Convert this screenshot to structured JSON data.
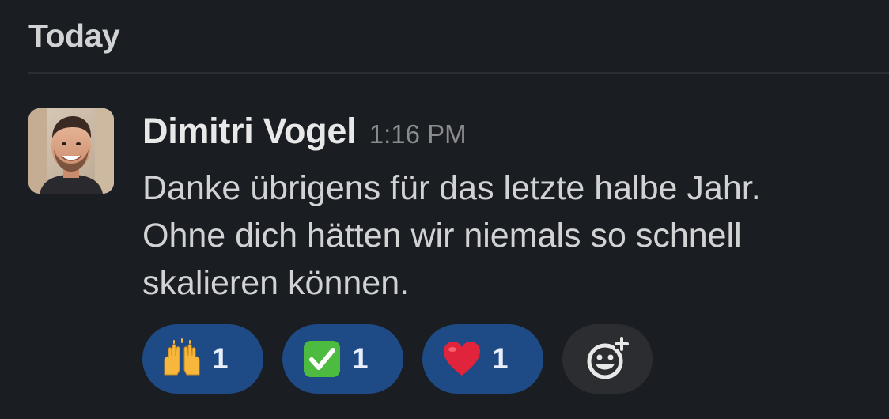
{
  "day_divider": {
    "label": "Today"
  },
  "message": {
    "sender": "Dimitri Vogel",
    "timestamp": "1:16 PM",
    "lines": [
      "Danke übrigens für das letzte halbe Jahr.",
      "Ohne dich hätten wir niemals so schnell",
      "skalieren können."
    ],
    "avatar_icon": "avatar-photo"
  },
  "reactions": [
    {
      "emoji": "raising-hands",
      "count": "1"
    },
    {
      "emoji": "white-check-mark",
      "count": "1"
    },
    {
      "emoji": "red-heart",
      "count": "1"
    }
  ],
  "add_reaction": {
    "icon": "add-emoji-icon"
  },
  "colors": {
    "background": "#1a1d21",
    "reaction_bg": "#1e4a86",
    "add_reaction_bg": "#2c2d31",
    "timestamp": "#8a8b8d",
    "check_green": "#4dbb3f",
    "heart_red": "#e0243b"
  }
}
